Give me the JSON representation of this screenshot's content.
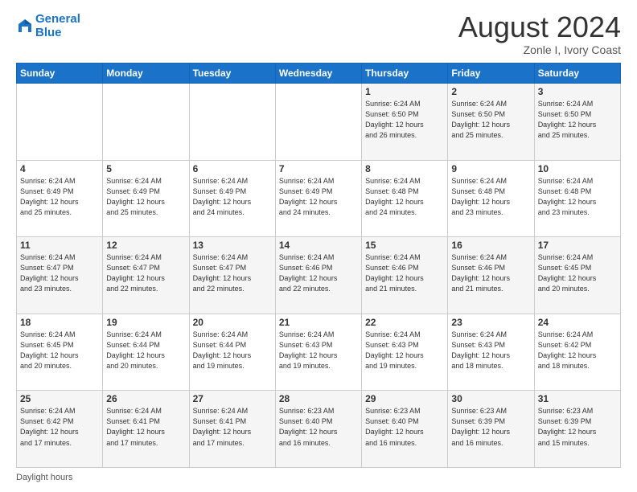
{
  "header": {
    "logo_line1": "General",
    "logo_line2": "Blue",
    "month_title": "August 2024",
    "location": "Zonle I, Ivory Coast"
  },
  "days_of_week": [
    "Sunday",
    "Monday",
    "Tuesday",
    "Wednesday",
    "Thursday",
    "Friday",
    "Saturday"
  ],
  "weeks": [
    [
      {
        "day": "",
        "info": ""
      },
      {
        "day": "",
        "info": ""
      },
      {
        "day": "",
        "info": ""
      },
      {
        "day": "",
        "info": ""
      },
      {
        "day": "1",
        "info": "Sunrise: 6:24 AM\nSunset: 6:50 PM\nDaylight: 12 hours\nand 26 minutes."
      },
      {
        "day": "2",
        "info": "Sunrise: 6:24 AM\nSunset: 6:50 PM\nDaylight: 12 hours\nand 25 minutes."
      },
      {
        "day": "3",
        "info": "Sunrise: 6:24 AM\nSunset: 6:50 PM\nDaylight: 12 hours\nand 25 minutes."
      }
    ],
    [
      {
        "day": "4",
        "info": "Sunrise: 6:24 AM\nSunset: 6:49 PM\nDaylight: 12 hours\nand 25 minutes."
      },
      {
        "day": "5",
        "info": "Sunrise: 6:24 AM\nSunset: 6:49 PM\nDaylight: 12 hours\nand 25 minutes."
      },
      {
        "day": "6",
        "info": "Sunrise: 6:24 AM\nSunset: 6:49 PM\nDaylight: 12 hours\nand 24 minutes."
      },
      {
        "day": "7",
        "info": "Sunrise: 6:24 AM\nSunset: 6:49 PM\nDaylight: 12 hours\nand 24 minutes."
      },
      {
        "day": "8",
        "info": "Sunrise: 6:24 AM\nSunset: 6:48 PM\nDaylight: 12 hours\nand 24 minutes."
      },
      {
        "day": "9",
        "info": "Sunrise: 6:24 AM\nSunset: 6:48 PM\nDaylight: 12 hours\nand 23 minutes."
      },
      {
        "day": "10",
        "info": "Sunrise: 6:24 AM\nSunset: 6:48 PM\nDaylight: 12 hours\nand 23 minutes."
      }
    ],
    [
      {
        "day": "11",
        "info": "Sunrise: 6:24 AM\nSunset: 6:47 PM\nDaylight: 12 hours\nand 23 minutes."
      },
      {
        "day": "12",
        "info": "Sunrise: 6:24 AM\nSunset: 6:47 PM\nDaylight: 12 hours\nand 22 minutes."
      },
      {
        "day": "13",
        "info": "Sunrise: 6:24 AM\nSunset: 6:47 PM\nDaylight: 12 hours\nand 22 minutes."
      },
      {
        "day": "14",
        "info": "Sunrise: 6:24 AM\nSunset: 6:46 PM\nDaylight: 12 hours\nand 22 minutes."
      },
      {
        "day": "15",
        "info": "Sunrise: 6:24 AM\nSunset: 6:46 PM\nDaylight: 12 hours\nand 21 minutes."
      },
      {
        "day": "16",
        "info": "Sunrise: 6:24 AM\nSunset: 6:46 PM\nDaylight: 12 hours\nand 21 minutes."
      },
      {
        "day": "17",
        "info": "Sunrise: 6:24 AM\nSunset: 6:45 PM\nDaylight: 12 hours\nand 20 minutes."
      }
    ],
    [
      {
        "day": "18",
        "info": "Sunrise: 6:24 AM\nSunset: 6:45 PM\nDaylight: 12 hours\nand 20 minutes."
      },
      {
        "day": "19",
        "info": "Sunrise: 6:24 AM\nSunset: 6:44 PM\nDaylight: 12 hours\nand 20 minutes."
      },
      {
        "day": "20",
        "info": "Sunrise: 6:24 AM\nSunset: 6:44 PM\nDaylight: 12 hours\nand 19 minutes."
      },
      {
        "day": "21",
        "info": "Sunrise: 6:24 AM\nSunset: 6:43 PM\nDaylight: 12 hours\nand 19 minutes."
      },
      {
        "day": "22",
        "info": "Sunrise: 6:24 AM\nSunset: 6:43 PM\nDaylight: 12 hours\nand 19 minutes."
      },
      {
        "day": "23",
        "info": "Sunrise: 6:24 AM\nSunset: 6:43 PM\nDaylight: 12 hours\nand 18 minutes."
      },
      {
        "day": "24",
        "info": "Sunrise: 6:24 AM\nSunset: 6:42 PM\nDaylight: 12 hours\nand 18 minutes."
      }
    ],
    [
      {
        "day": "25",
        "info": "Sunrise: 6:24 AM\nSunset: 6:42 PM\nDaylight: 12 hours\nand 17 minutes."
      },
      {
        "day": "26",
        "info": "Sunrise: 6:24 AM\nSunset: 6:41 PM\nDaylight: 12 hours\nand 17 minutes."
      },
      {
        "day": "27",
        "info": "Sunrise: 6:24 AM\nSunset: 6:41 PM\nDaylight: 12 hours\nand 17 minutes."
      },
      {
        "day": "28",
        "info": "Sunrise: 6:23 AM\nSunset: 6:40 PM\nDaylight: 12 hours\nand 16 minutes."
      },
      {
        "day": "29",
        "info": "Sunrise: 6:23 AM\nSunset: 6:40 PM\nDaylight: 12 hours\nand 16 minutes."
      },
      {
        "day": "30",
        "info": "Sunrise: 6:23 AM\nSunset: 6:39 PM\nDaylight: 12 hours\nand 16 minutes."
      },
      {
        "day": "31",
        "info": "Sunrise: 6:23 AM\nSunset: 6:39 PM\nDaylight: 12 hours\nand 15 minutes."
      }
    ]
  ],
  "footer": {
    "label": "Daylight hours"
  }
}
